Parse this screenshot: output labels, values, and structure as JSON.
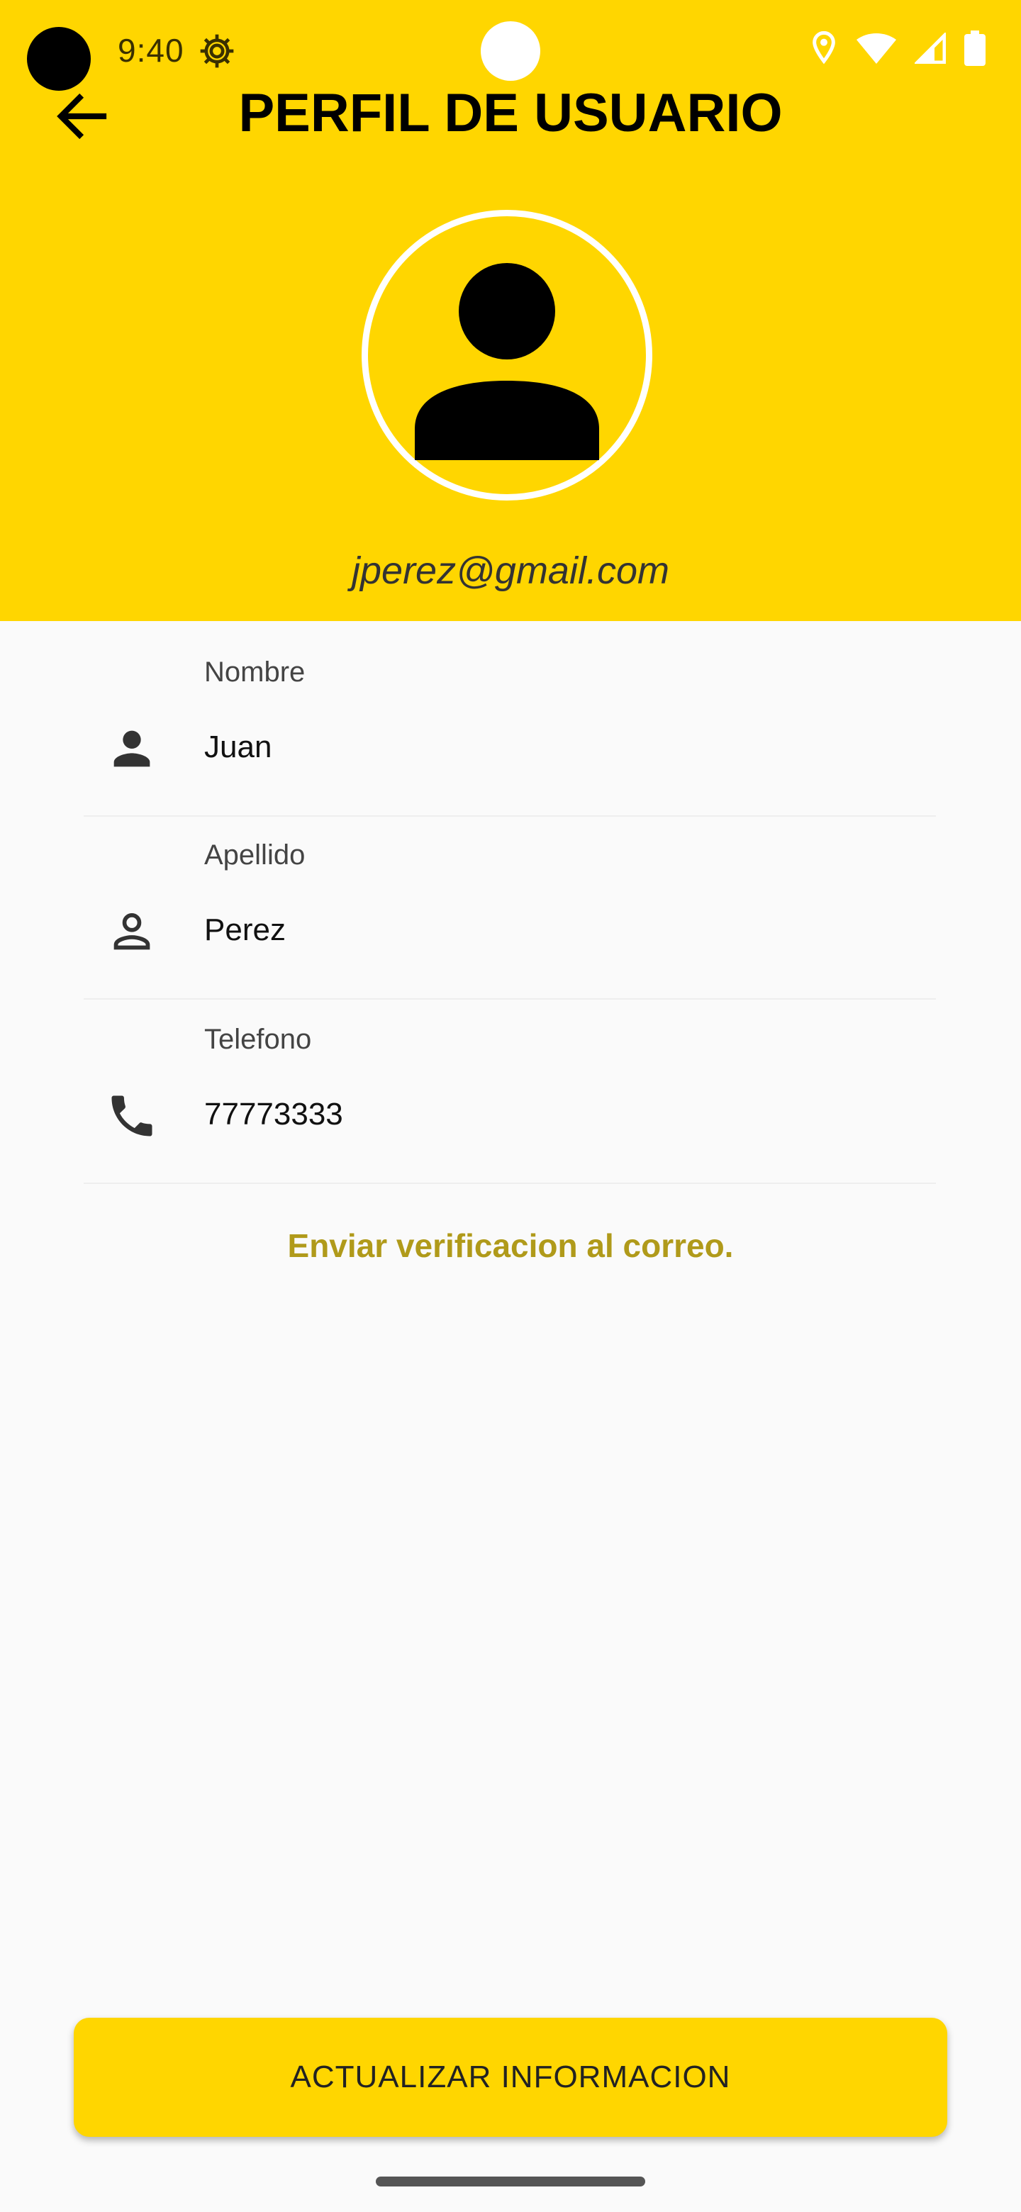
{
  "status_bar": {
    "time": "9:40"
  },
  "app_bar": {
    "title": "PERFIL DE USUARIO"
  },
  "profile": {
    "email": "jperez@gmail.com"
  },
  "form": {
    "fields": [
      {
        "label": "Nombre",
        "value": "Juan",
        "icon": "person-icon"
      },
      {
        "label": "Apellido",
        "value": "Perez",
        "icon": "person-outline-icon"
      },
      {
        "label": "Telefono",
        "value": "77773333",
        "icon": "phone-icon"
      }
    ]
  },
  "actions": {
    "verify_email_label": "Enviar verificacion al correo.",
    "update_button_label": "ACTUALIZAR INFORMACION"
  },
  "colors": {
    "accent": "#ffd600",
    "link": "#b09a1a",
    "background": "#fafafa"
  }
}
